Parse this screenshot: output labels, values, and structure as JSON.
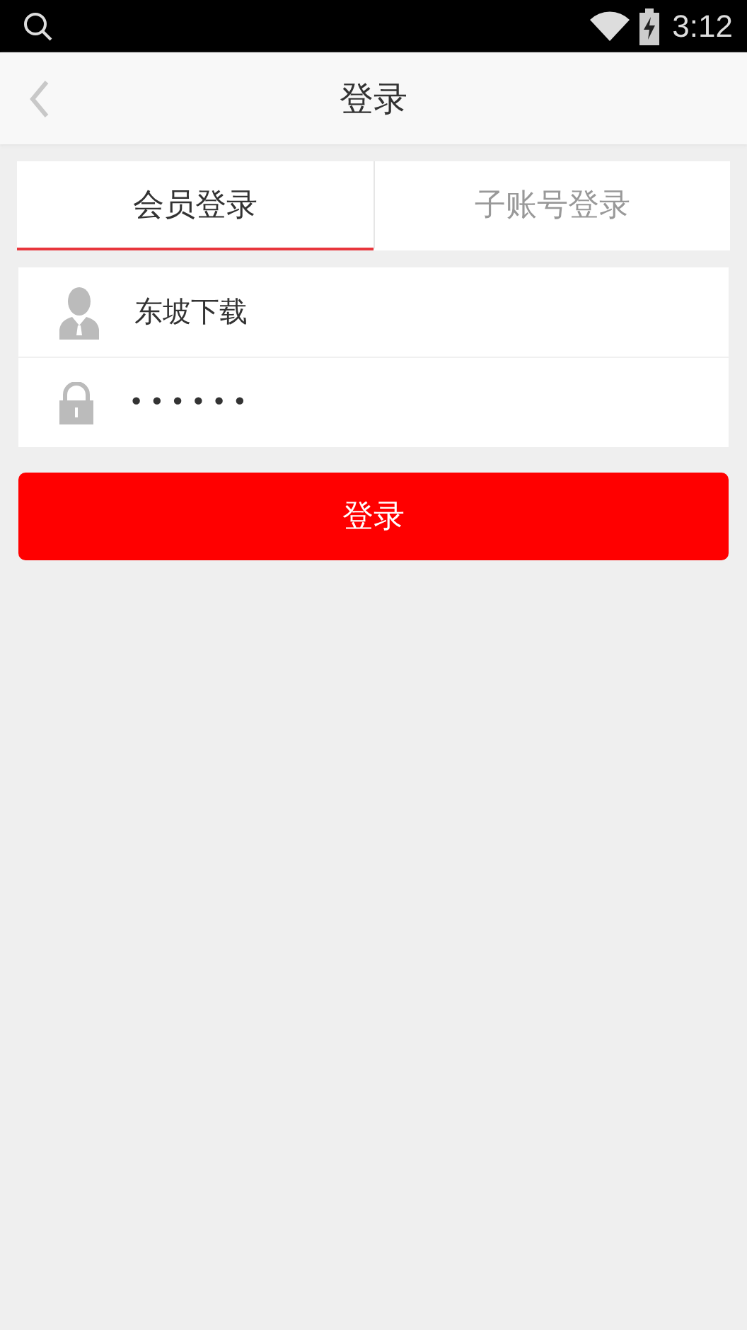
{
  "status_bar": {
    "time": "3:12"
  },
  "header": {
    "title": "登录"
  },
  "tabs": [
    {
      "label": "会员登录",
      "selected": true
    },
    {
      "label": "子账号登录",
      "selected": false
    }
  ],
  "fields": [
    {
      "kind": "user",
      "value": "东坡下载"
    },
    {
      "kind": "password",
      "value": "••••••"
    }
  ],
  "submit_button": "登录"
}
